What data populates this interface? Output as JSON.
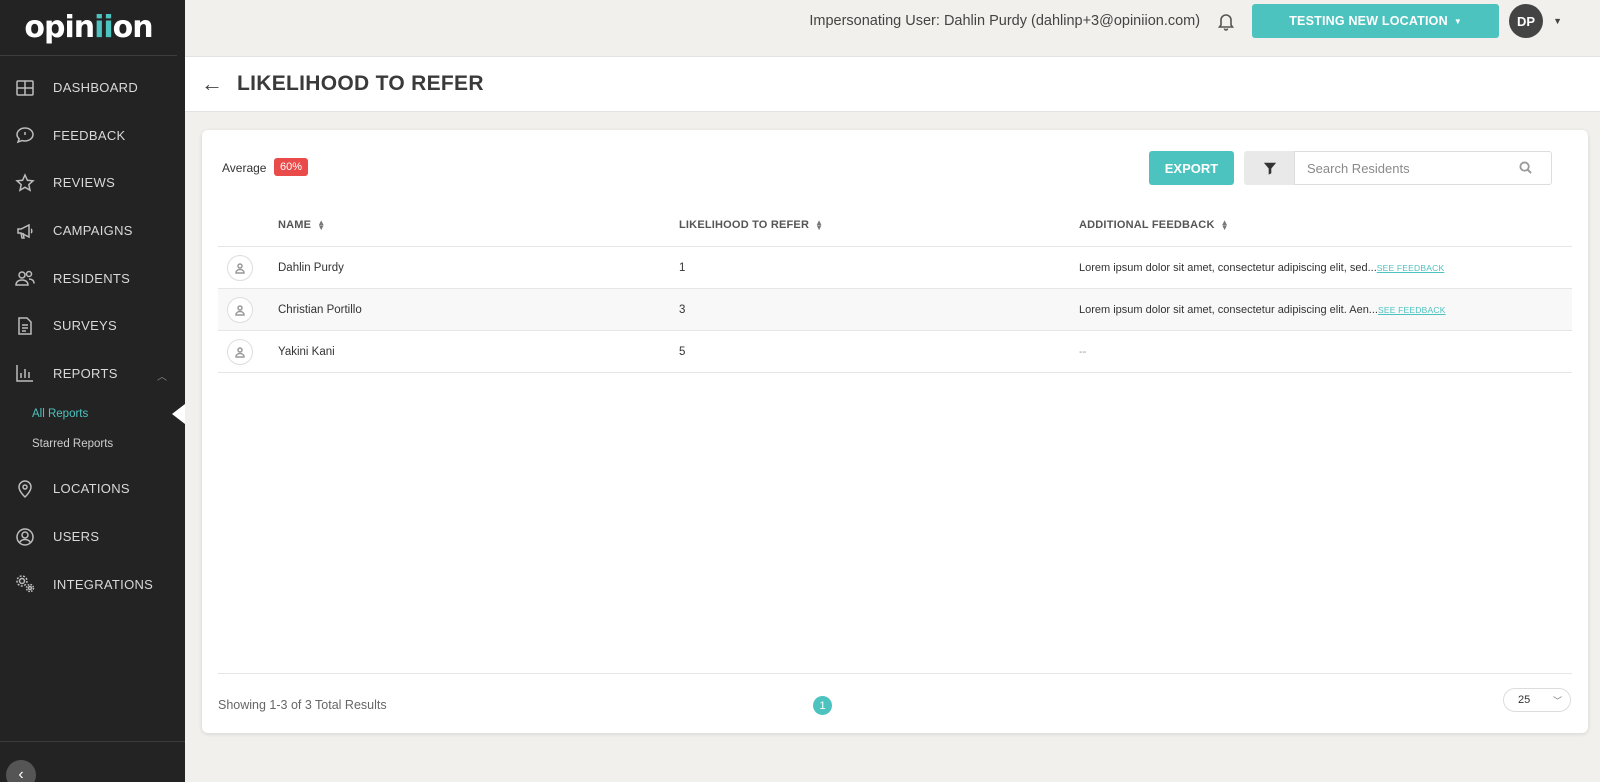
{
  "brand": {
    "logo_pre": "opin",
    "logo_ii": "ii",
    "logo_post": "on"
  },
  "sidebar": {
    "items": [
      {
        "label": "DASHBOARD",
        "icon": "grid-icon"
      },
      {
        "label": "FEEDBACK",
        "icon": "chat-bubble-icon"
      },
      {
        "label": "REVIEWS",
        "icon": "star-icon"
      },
      {
        "label": "CAMPAIGNS",
        "icon": "megaphone-icon"
      },
      {
        "label": "RESIDENTS",
        "icon": "people-icon"
      },
      {
        "label": "SURVEYS",
        "icon": "document-icon"
      },
      {
        "label": "REPORTS",
        "icon": "bar-chart-icon"
      }
    ],
    "reports_sub": [
      "All Reports",
      "Starred Reports"
    ],
    "items_after": [
      {
        "label": "LOCATIONS",
        "icon": "map-pin-icon"
      },
      {
        "label": "USERS",
        "icon": "user-circle-icon"
      },
      {
        "label": "INTEGRATIONS",
        "icon": "gears-icon"
      }
    ],
    "collapse_glyph": "‹"
  },
  "topbar": {
    "impersonating": "Impersonating User: Dahlin Purdy (dahlinp+3@opiniion.com)",
    "location_button": "TESTING NEW LOCATION",
    "avatar_initials": "DP"
  },
  "page": {
    "title": "LIKELIHOOD TO REFER",
    "back_glyph": "←"
  },
  "summary": {
    "average_label": "Average",
    "average_value": "60%",
    "average_color": "#e94b4b"
  },
  "toolbar": {
    "export_label": "EXPORT",
    "search_placeholder": "Search Residents"
  },
  "table": {
    "headers": [
      "NAME",
      "LIKELIHOOD TO REFER",
      "ADDITIONAL FEEDBACK"
    ],
    "rows": [
      {
        "name": "Dahlin Purdy",
        "score": "1",
        "feedback": "Lorem ipsum dolor sit amet, consectetur adipiscing elit, sed...",
        "link": "SEE FEEDBACK"
      },
      {
        "name": "Christian Portillo",
        "score": "3",
        "feedback": "Lorem ipsum dolor sit amet, consectetur adipiscing elit. Aen...",
        "link": "SEE FEEDBACK"
      },
      {
        "name": "Yakini Kani",
        "score": "5",
        "feedback": "--",
        "link": ""
      }
    ]
  },
  "footer": {
    "showing": "Showing 1-3 of 3 Total Results",
    "current_page": "1",
    "per_page": "25"
  },
  "colors": {
    "accent": "#4dc3bf",
    "sidebar_bg": "#232323",
    "danger": "#e94b4b"
  }
}
